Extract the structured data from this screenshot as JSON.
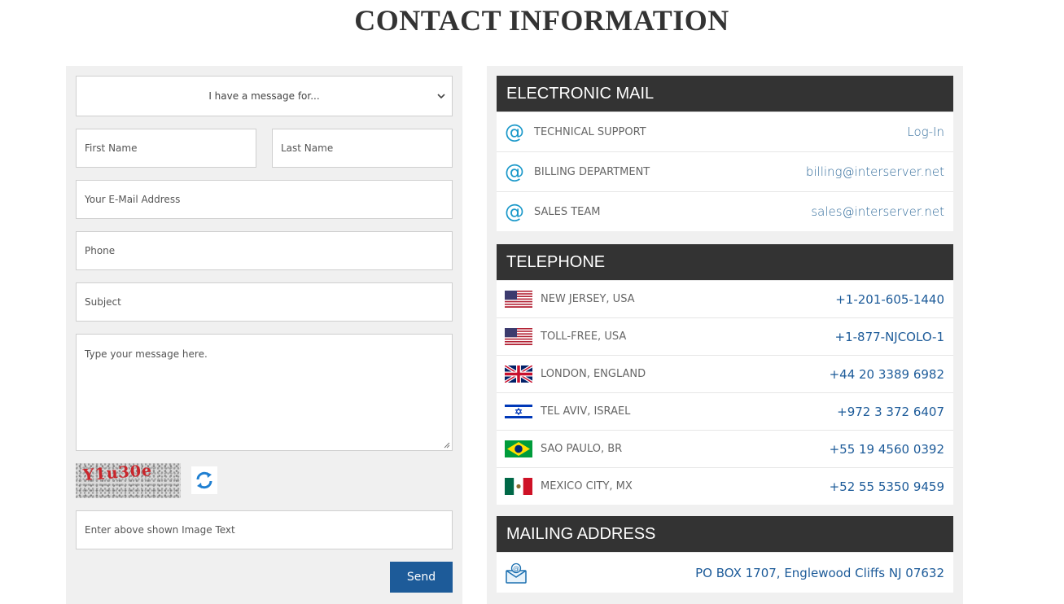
{
  "page": {
    "title": "CONTACT INFORMATION"
  },
  "form": {
    "recipient_select": {
      "value": "I have a message for..."
    },
    "first_name": {
      "placeholder": "First Name"
    },
    "last_name": {
      "placeholder": "Last Name"
    },
    "email": {
      "placeholder": "Your E-Mail Address"
    },
    "phone": {
      "placeholder": "Phone"
    },
    "subject": {
      "placeholder": "Subject"
    },
    "message": {
      "placeholder": "Type your message here."
    },
    "captcha": {
      "image_text": "Y1u30e",
      "input_placeholder": "Enter above shown Image Text"
    },
    "send_label": "Send"
  },
  "email_section": {
    "header": "ELECTRONIC MAIL",
    "rows": [
      {
        "icon": "at-icon",
        "label": "TECHNICAL SUPPORT",
        "value": "Log-In"
      },
      {
        "icon": "at-icon",
        "label": "BILLING DEPARTMENT",
        "value": "billing@interserver.net"
      },
      {
        "icon": "at-icon",
        "label": "SALES TEAM",
        "value": "sales@interserver.net"
      }
    ]
  },
  "phone_section": {
    "header": "TELEPHONE",
    "rows": [
      {
        "icon": "us-flag-icon",
        "label": "NEW JERSEY, USA",
        "value": "+1-201-605-1440"
      },
      {
        "icon": "us-flag-icon",
        "label": "TOLL-FREE, USA",
        "value": "+1-877-NJCOLO-1"
      },
      {
        "icon": "uk-flag-icon",
        "label": "LONDON, ENGLAND",
        "value": "+44 20 3389 6982"
      },
      {
        "icon": "israel-flag-icon",
        "label": "TEL AVIV, ISRAEL",
        "value": "+972 3 372 6407"
      },
      {
        "icon": "brazil-flag-icon",
        "label": "SAO PAULO, BR",
        "value": "+55 19 4560 0392"
      },
      {
        "icon": "mexico-flag-icon",
        "label": "MEXICO CITY, MX",
        "value": "+52 55 5350 9459"
      }
    ]
  },
  "mail_section": {
    "header": "MAILING ADDRESS",
    "rows": [
      {
        "icon": "envelope-icon",
        "value": "PO BOX 1707, Englewood Cliffs NJ 07632"
      }
    ]
  },
  "colors": {
    "header_bg": "#333333",
    "accent_blue": "#1d5b99",
    "at_icon": "#1a98c9",
    "captcha_text": "#c9262c",
    "panel_bg": "#f0f0f0"
  }
}
